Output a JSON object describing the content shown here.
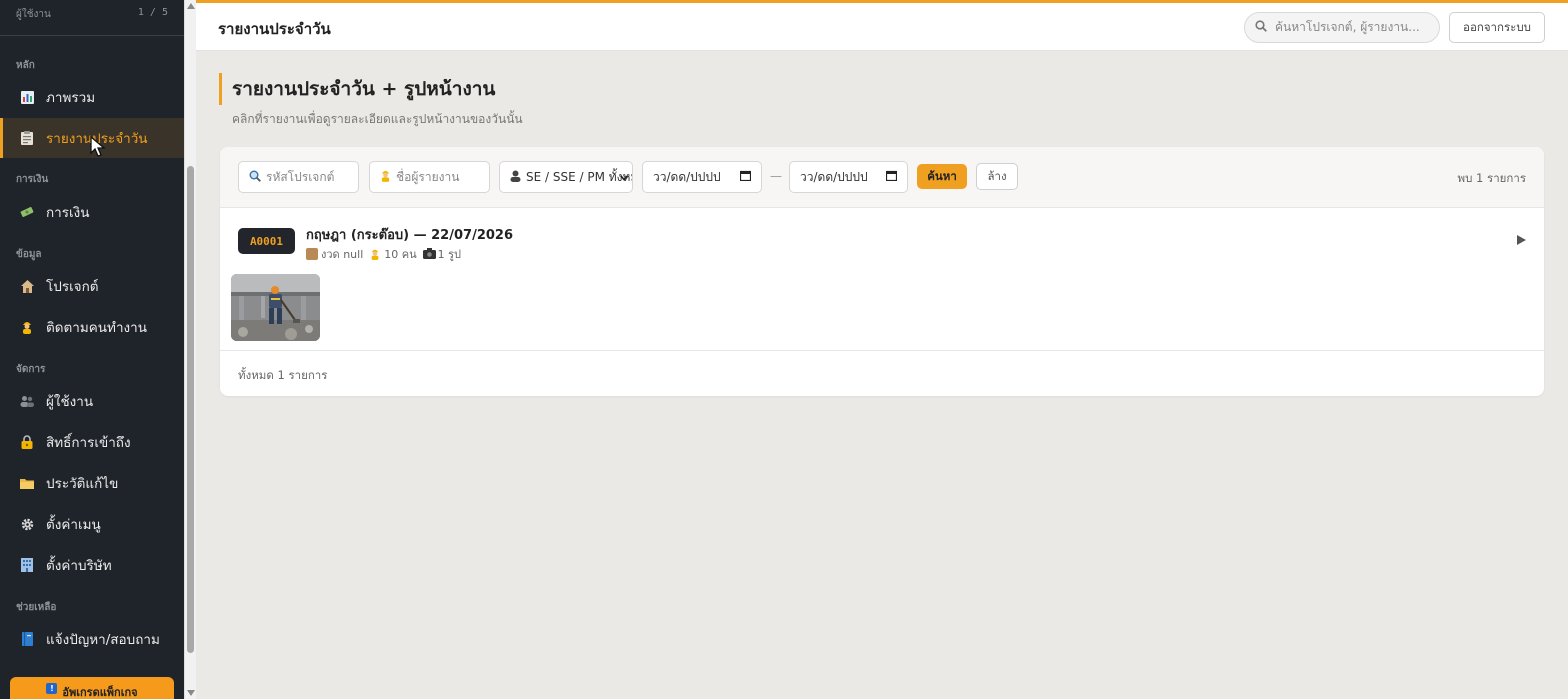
{
  "sidebar": {
    "top_label": "ผู้ใช้งาน",
    "page_indicator": "1 / 5",
    "sections": {
      "main": "หลัก",
      "finance": "การเงิน",
      "data": "ข้อมูล",
      "manage": "จัดการ",
      "help": "ช่วยเหลือ"
    },
    "items": [
      {
        "label": "ภาพรวม",
        "icon": "bar-chart-icon"
      },
      {
        "label": "รายงานประจำวัน",
        "icon": "clipboard-icon",
        "active": true
      },
      {
        "label": "การเงิน",
        "icon": "money-icon"
      },
      {
        "label": "โปรเจกต์",
        "icon": "house-icon"
      },
      {
        "label": "ติดตามคนทำงาน",
        "icon": "worker-icon"
      },
      {
        "label": "ผู้ใช้งาน",
        "icon": "users-icon"
      },
      {
        "label": "สิทธิ์การเข้าถึง",
        "icon": "lock-icon"
      },
      {
        "label": "ประวัติแก้ไข",
        "icon": "folder-icon"
      },
      {
        "label": "ตั้งค่าเมนู",
        "icon": "gear-icon"
      },
      {
        "label": "ตั้งค่าบริษัท",
        "icon": "building-icon"
      },
      {
        "label": "แจ้งปัญหา/สอบถาม",
        "icon": "book-icon"
      }
    ],
    "upgrade_label": "อัพเกรดแพ็กเกจ"
  },
  "topbar": {
    "title": "รายงานประจำวัน",
    "search_placeholder": "ค้นหาโปรเจกต์, ผู้รายงาน...",
    "logout_label": "ออกจากระบบ"
  },
  "page": {
    "heading": "รายงานประจำวัน + รูปหน้างาน",
    "subheading": "คลิกที่รายงานเพื่อดูรายละเอียดและรูปหน้างานของวันนั้น"
  },
  "filters": {
    "project_code_placeholder": "รหัสโปรเจกต์",
    "reporter_placeholder": "ชื่อผู้รายงาน",
    "role_select_value": "SE / SSE / PM ทั้งหมด",
    "date_from_placeholder": "วว/ดด/ปปปป",
    "date_to_placeholder": "วว/ดด/ปปปป",
    "date_separator": "—",
    "search_button": "ค้นหา",
    "clear_button": "ล้าง",
    "found_text": "พบ 1 รายการ"
  },
  "reports": [
    {
      "code": "A0001",
      "title": "กฤษฎา (กระต๊อบ) — 22/07/2026",
      "installment": "งวด null",
      "workers": "10 คน",
      "photos": "1 รูป"
    }
  ],
  "footer": {
    "total_text": "ทั้งหมด 1 รายการ"
  },
  "colors": {
    "accent": "#f0a020",
    "sidebar_bg": "#1f232a",
    "page_bg": "#ebe9e6"
  }
}
